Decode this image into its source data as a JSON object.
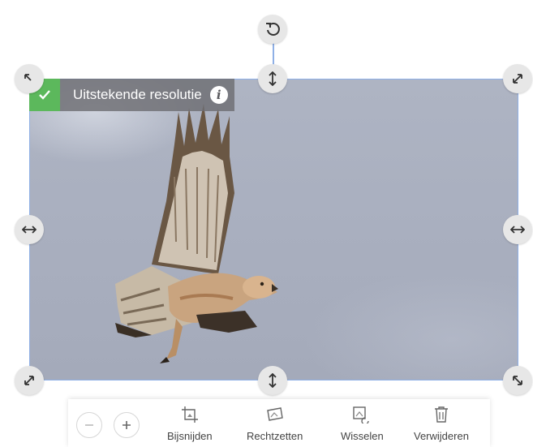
{
  "resolution_badge": {
    "label": "Uitstekende resolutie"
  },
  "toolbar": {
    "tools": [
      {
        "label": "Bijsnijden",
        "icon": "crop-icon"
      },
      {
        "label": "Rechtzetten",
        "icon": "straighten-icon"
      },
      {
        "label": "Wisselen",
        "icon": "swap-image-icon"
      },
      {
        "label": "Verwijderen",
        "icon": "trash-icon"
      }
    ],
    "zoom_out_icon": "minus-icon",
    "zoom_in_icon": "plus-icon"
  },
  "colors": {
    "selection_border": "#8fb0e6",
    "badge_check": "#5cb85c",
    "handle_bg": "#e7e7e7"
  }
}
